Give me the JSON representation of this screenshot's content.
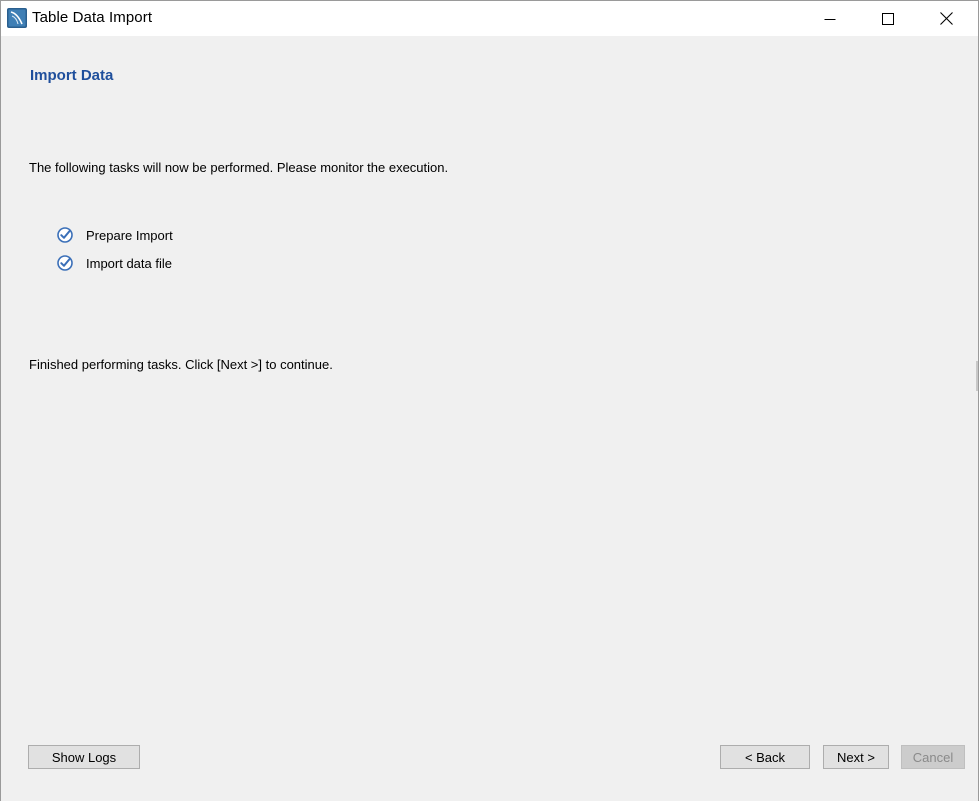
{
  "window": {
    "title": "Table Data Import",
    "app_icon": "mysql-workbench-icon"
  },
  "page": {
    "title": "Import Data",
    "intro": "The following tasks will now be performed. Please monitor the execution.",
    "tasks": [
      {
        "label": "Prepare Import",
        "status": "done",
        "icon": "check-circle-icon"
      },
      {
        "label": "Import data file",
        "status": "done",
        "icon": "check-circle-icon"
      }
    ],
    "finish_message": "Finished performing tasks. Click [Next >] to continue."
  },
  "buttons": {
    "show_logs": "Show Logs",
    "back": "< Back",
    "next": "Next >",
    "cancel": "Cancel"
  },
  "colors": {
    "title_blue": "#1f4f9c",
    "check_blue": "#3a6fb8",
    "background": "#f0f0f0",
    "disabled_text": "#8a8a8a"
  }
}
